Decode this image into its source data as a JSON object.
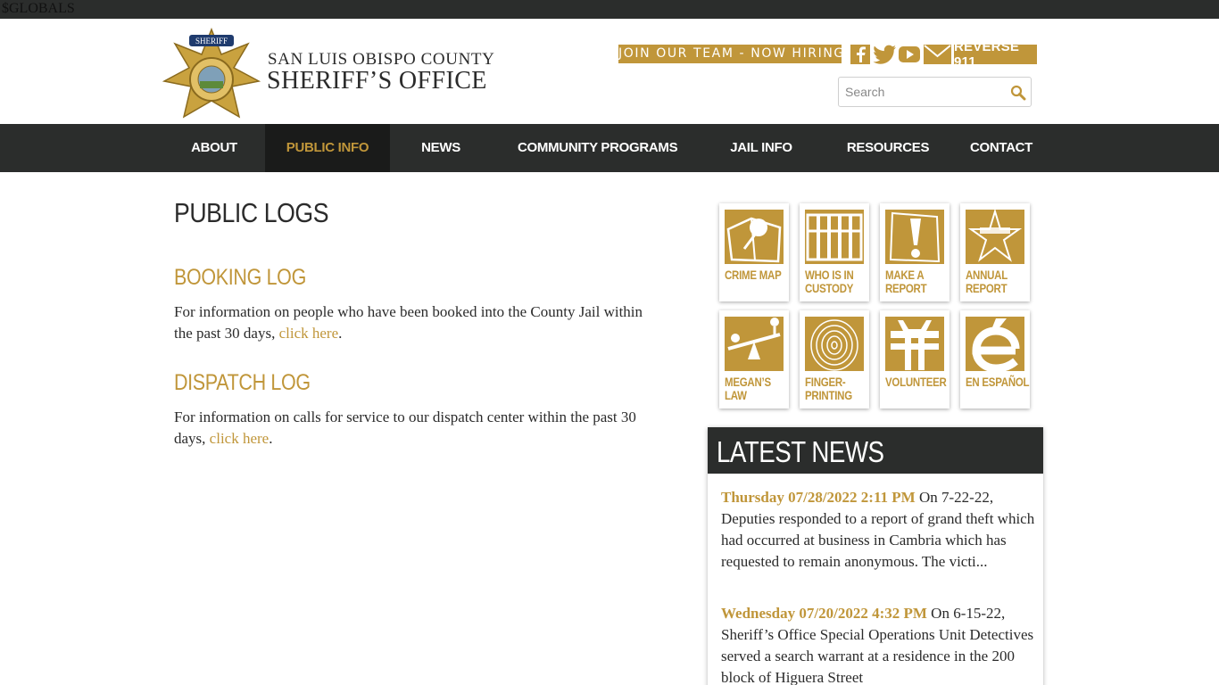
{
  "topbar": {
    "text": "$GLOBALS"
  },
  "header": {
    "title_line1": "SAN LUIS OBISPO COUNTY",
    "title_line2": "SHERIFF’S OFFICE",
    "badge_text": "SHERIFF",
    "join_label": "JOIN OUR TEAM - NOW HIRING",
    "reverse911_label": "REVERSE 911",
    "search_placeholder": "Search"
  },
  "colors": {
    "gold": "#c0963a",
    "dark": "#2b2d2c"
  },
  "nav": {
    "items": [
      {
        "label": "ABOUT"
      },
      {
        "label": "PUBLIC INFO"
      },
      {
        "label": "NEWS"
      },
      {
        "label": "COMMUNITY PROGRAMS"
      },
      {
        "label": "JAIL INFO"
      },
      {
        "label": "RESOURCES"
      },
      {
        "label": "CONTACT"
      }
    ],
    "active": "PUBLIC INFO"
  },
  "main": {
    "page_title": "PUBLIC LOGS",
    "sections": [
      {
        "title": "BOOKING LOG",
        "text": "For information on people who have been booked into the County Jail within the past 30 days, ",
        "link": "click here",
        "tail": "."
      },
      {
        "title": "DISPATCH LOG",
        "text": "For information on calls for service to our dispatch center within the past 30 days, ",
        "link": "click here",
        "tail": "."
      }
    ]
  },
  "tiles": [
    {
      "line1": "CRIME MAP",
      "line2": "",
      "icon": "map-pin-icon"
    },
    {
      "line1": "WHO IS IN",
      "line2": "CUSTODY",
      "icon": "jail-bars-icon"
    },
    {
      "line1": "MAKE A",
      "line2": "REPORT",
      "icon": "exclamation-icon"
    },
    {
      "line1": "ANNUAL",
      "line2": "REPORT",
      "icon": "star-badge-icon"
    },
    {
      "line1": "MEGAN’S",
      "line2": "LAW",
      "icon": "seesaw-icon"
    },
    {
      "line1": "FINGER-",
      "line2": "PRINTING",
      "icon": "fingerprint-icon"
    },
    {
      "line1": "VOLUNTEER",
      "line2": "",
      "icon": "volunteer-icon"
    },
    {
      "line1": "EN ESPAÑOL",
      "line2": "",
      "icon": "accent-e-icon"
    }
  ],
  "news": {
    "title": "LATEST NEWS",
    "items": [
      {
        "date": "Thursday 07/28/2022 2:11 PM",
        "text": " On 7-22-22, Deputies responded to a report of grand theft which had occurred at business in Cambria which has requested to remain anonymous. The victi..."
      },
      {
        "date": "Wednesday 07/20/2022 4:32 PM",
        "text": " On 6-15-22, Sheriff’s Office Special Operations Unit Detectives served a search warrant at a residence in the 200 block of Higuera Street"
      }
    ]
  }
}
